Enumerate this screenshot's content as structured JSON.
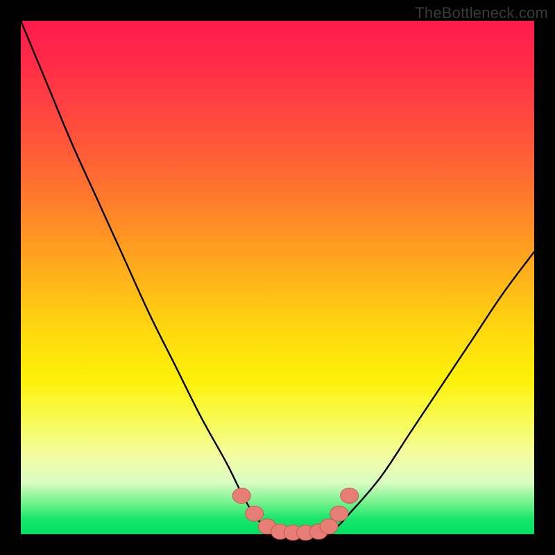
{
  "watermark": "TheBottleneck.com",
  "colors": {
    "frame": "#000000",
    "curve": "#000000",
    "marker_fill": "#e77e76",
    "marker_stroke": "#c95b53"
  },
  "chart_data": {
    "type": "line",
    "title": "",
    "xlabel": "",
    "ylabel": "",
    "xlim": [
      0,
      100
    ],
    "ylim": [
      0,
      100
    ],
    "grid": false,
    "legend": false,
    "note": "Values estimated from pixel positions; the chart has no visible axis ticks or numeric labels. x ≈ horizontal %, y ≈ bottleneck % (0 at bottom / green band).",
    "series": [
      {
        "name": "bottleneck-curve",
        "x": [
          0,
          5,
          10,
          15,
          20,
          25,
          30,
          35,
          40,
          43,
          46,
          49,
          52,
          55,
          58,
          61,
          64,
          70,
          76,
          82,
          88,
          94,
          100
        ],
        "y": [
          100,
          88,
          76,
          65,
          54,
          43,
          33,
          23,
          14,
          8,
          3,
          1,
          0,
          0,
          0,
          1,
          4,
          11,
          20,
          29,
          38,
          47,
          55
        ]
      }
    ],
    "markers": {
      "name": "highlighted-points",
      "x": [
        43.0,
        45.5,
        48.0,
        50.5,
        53.0,
        55.5,
        58.0,
        60.0,
        62.0,
        64.0
      ],
      "y": [
        7.5,
        4.0,
        1.5,
        0.5,
        0.3,
        0.3,
        0.5,
        1.5,
        4.0,
        7.5
      ]
    }
  }
}
